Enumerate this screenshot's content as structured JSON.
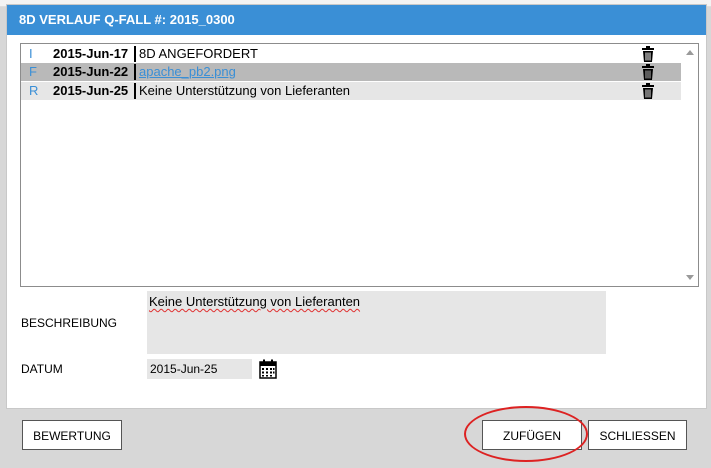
{
  "dialog": {
    "title": "8D VERLAUF Q-FALL #: 2015_0300"
  },
  "entries": [
    {
      "code": "I",
      "date": "2015-Jun-17",
      "text": "8D ANGEFORDERT"
    },
    {
      "code": "F",
      "date": "2015-Jun-22",
      "text": "apache_pb2.png"
    },
    {
      "code": "R",
      "date": "2015-Jun-25",
      "text": "Keine Unterstützung von Lieferanten"
    }
  ],
  "form": {
    "description_label": "BESCHREIBUNG",
    "description_value": "Keine Unterstützung von Lieferanten",
    "date_label": "DATUM",
    "date_value": "2015-Jun-25"
  },
  "buttons": {
    "bewertung": "BEWERTUNG",
    "zufuegen": "ZUFÜGEN",
    "schliessen": "SCHLIESSEN"
  },
  "icons": {
    "trash": "trash-icon",
    "calendar": "calendar-icon"
  },
  "colors": {
    "accent": "#3a8fd6",
    "highlight": "#d22222"
  }
}
